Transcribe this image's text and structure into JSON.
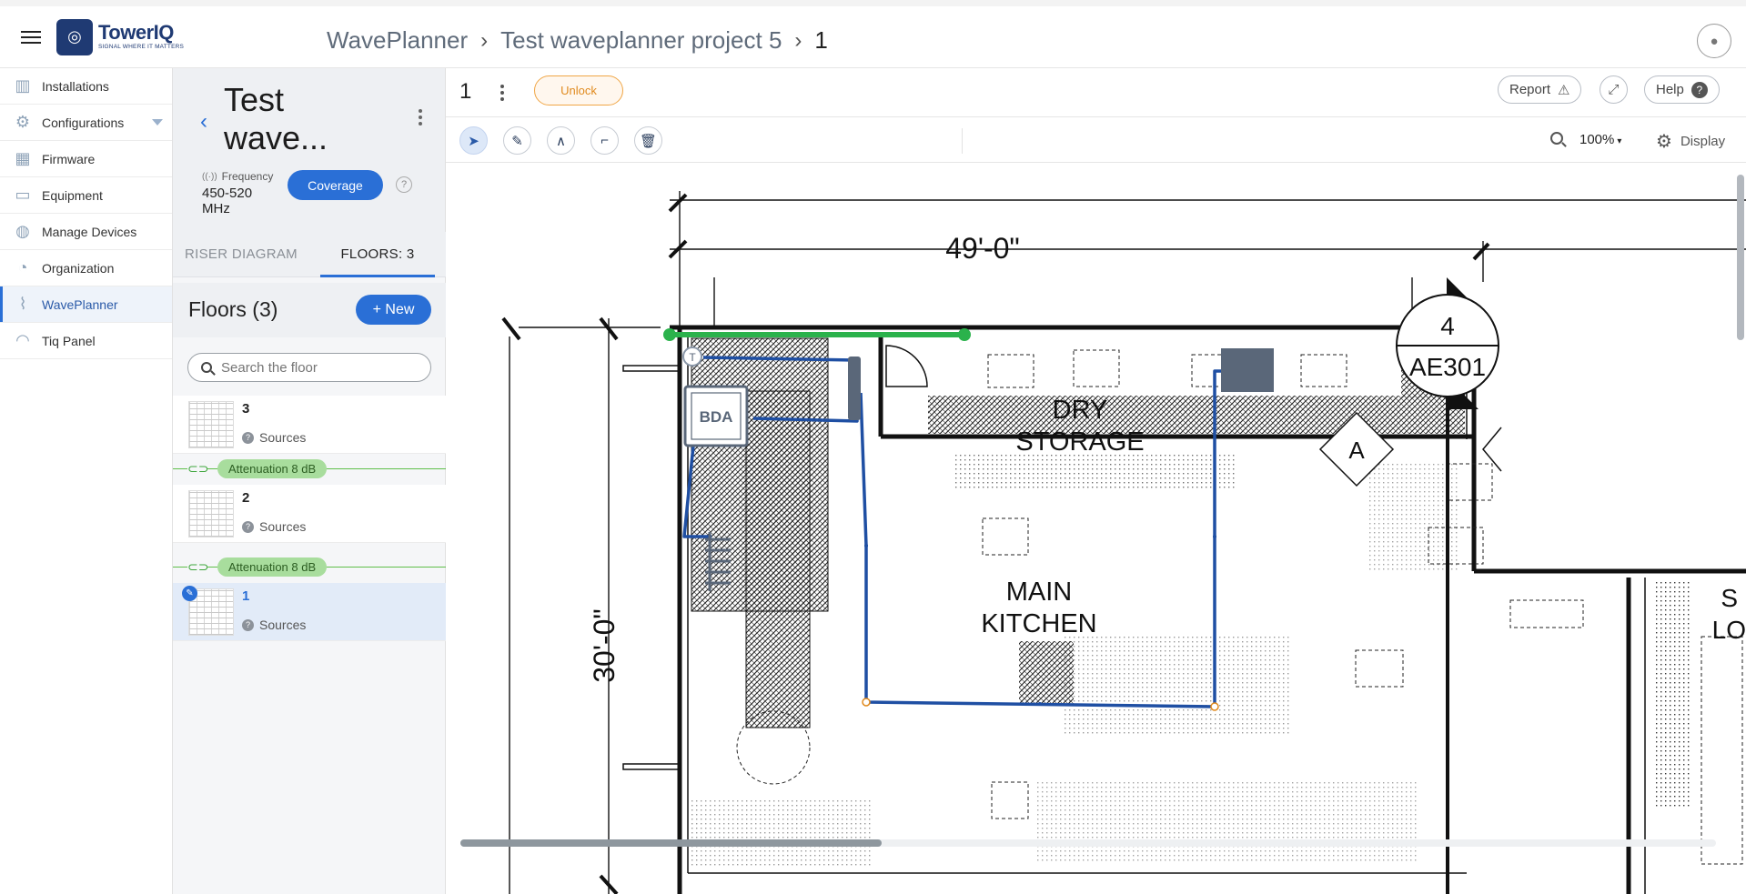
{
  "header": {
    "logo_name": "TowerIQ",
    "logo_tagline": "SIGNAL WHERE IT MATTERS",
    "breadcrumbs": [
      "WavePlanner",
      "Test waveplanner project 5",
      "1"
    ]
  },
  "nav": {
    "items": [
      {
        "label": "Installations",
        "icon": "building-icon"
      },
      {
        "label": "Configurations",
        "icon": "cog-network-icon"
      },
      {
        "label": "Firmware",
        "icon": "chip-icon"
      },
      {
        "label": "Equipment",
        "icon": "ruler-icon"
      },
      {
        "label": "Manage Devices",
        "icon": "devices-icon"
      },
      {
        "label": "Organization",
        "icon": "handshake-icon"
      },
      {
        "label": "WavePlanner",
        "icon": "waveplanner-icon"
      },
      {
        "label": "Tiq Panel",
        "icon": "signal-icon"
      }
    ],
    "active": "WavePlanner"
  },
  "project": {
    "title": "Test wave...",
    "frequency_label": "Frequency",
    "frequency_value": "450-520 MHz",
    "coverage_label": "Coverage",
    "tabs": [
      "RISER DIAGRAM",
      "FLOORS: 3"
    ],
    "active_tab": "FLOORS: 3"
  },
  "floors": {
    "heading": "Floors (3)",
    "new_label": "+ New",
    "search_placeholder": "Search the floor",
    "items": [
      {
        "name": "3",
        "sources": "Sources"
      },
      {
        "name": "2",
        "sources": "Sources"
      },
      {
        "name": "1",
        "sources": "Sources"
      }
    ],
    "attenuations": [
      "Attenuation 8 dB",
      "Attenuation 8 dB"
    ],
    "selected": "1"
  },
  "canvas": {
    "floor_label": "1",
    "unlock_label": "Unlock",
    "report_label": "Report",
    "help_label": "Help",
    "zoom": "100%",
    "display_label": "Display",
    "tools": [
      "select-icon",
      "pen-icon",
      "angle-icon",
      "eraser-icon",
      "trash-icon"
    ]
  },
  "drawing": {
    "dim_width": "49'-0\"",
    "dim_height": "30'-0\"",
    "rooms": [
      "DRY",
      "STORAGE",
      "MAIN",
      "KITCHEN"
    ],
    "device": "BDA",
    "tag_top": "4",
    "tag_bottom": "AE301",
    "diamond": "A",
    "edge_text_1": "S",
    "edge_text_2": "LO"
  },
  "colors": {
    "accent": "#2a6fd6",
    "cable": "#1f4fa3",
    "highlight": "#2bb24c",
    "unlock": "#e08a1e"
  }
}
